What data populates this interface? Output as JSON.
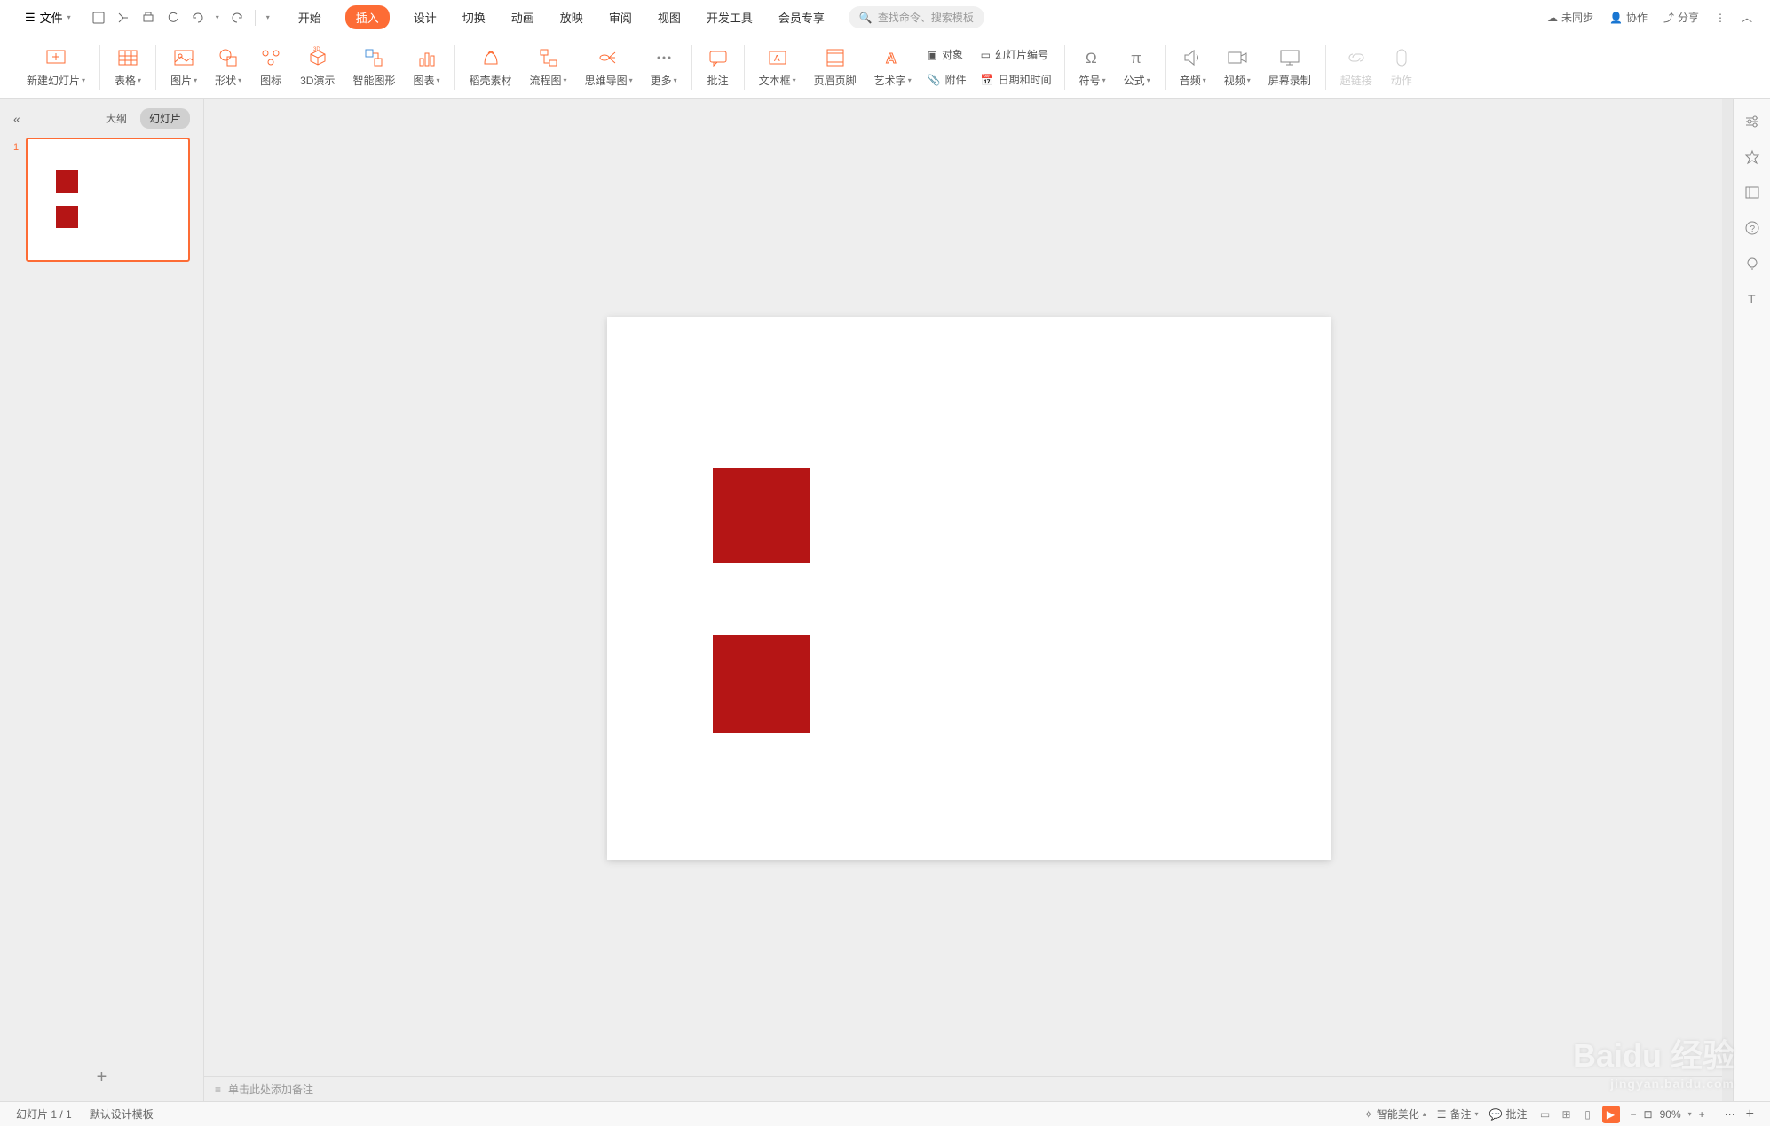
{
  "menubar": {
    "file": "文件",
    "tabs": [
      "开始",
      "插入",
      "设计",
      "切换",
      "动画",
      "放映",
      "审阅",
      "视图",
      "开发工具",
      "会员专享"
    ],
    "active_tab_index": 1,
    "search_placeholder": "查找命令、搜索模板",
    "top_right": {
      "sync": "未同步",
      "collab": "协作",
      "share": "分享"
    }
  },
  "ribbon": {
    "new_slide": "新建幻灯片",
    "table": "表格",
    "picture": "图片",
    "shapes": "形状",
    "icons": "图标",
    "three_d": "3D演示",
    "smartart": "智能图形",
    "chart": "图表",
    "docer": "稻壳素材",
    "flowchart": "流程图",
    "mindmap": "思维导图",
    "more": "更多",
    "comment": "批注",
    "textbox": "文本框",
    "header_footer": "页眉页脚",
    "wordart": "艺术字",
    "object": "对象",
    "slide_number": "幻灯片编号",
    "attachment": "附件",
    "datetime": "日期和时间",
    "symbol": "符号",
    "equation": "公式",
    "audio": "音频",
    "video": "视频",
    "screen_record": "屏幕录制",
    "hyperlink": "超链接",
    "action": "动作"
  },
  "slide_panel": {
    "outline": "大纲",
    "slides": "幻灯片",
    "slide_num": "1"
  },
  "notes": {
    "placeholder": "单击此处添加备注"
  },
  "right_sidebar": {
    "icons": [
      "settings-icon",
      "effects-icon",
      "layout-icon",
      "help-icon",
      "idea-icon",
      "text-icon"
    ]
  },
  "status_bar": {
    "slide_info": "幻灯片 1 / 1",
    "template": "默认设计模板",
    "beautify": "智能美化",
    "notes": "备注",
    "comments": "批注",
    "zoom": "90%"
  },
  "watermark": {
    "main": "Baidu 经验",
    "sub": "jingyan.baidu.com"
  }
}
